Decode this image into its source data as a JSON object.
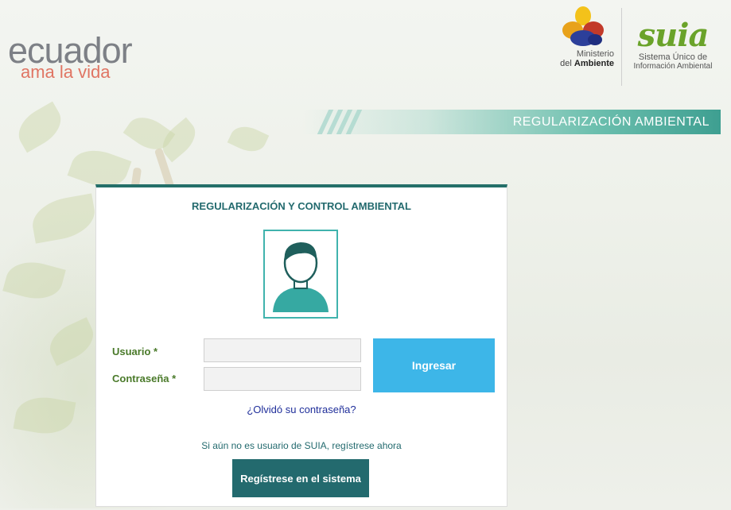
{
  "header": {
    "brand_main": "ecuador",
    "brand_sub": "ama la vida",
    "ministry_line1": "Ministerio",
    "ministry_line2_prefix": "del ",
    "ministry_line2_bold": "Ambiente",
    "suia_logo": "suia",
    "suia_line1": "Sistema Único de",
    "suia_line2": "Información Ambiental",
    "banner_text": "REGULARIZACIÓN AMBIENTAL"
  },
  "login": {
    "title": "REGULARIZACIÓN Y CONTROL AMBIENTAL",
    "avatar_icon": "user-avatar-icon",
    "user_label": "Usuario *",
    "user_value": "",
    "password_label": "Contraseña *",
    "password_value": "",
    "submit_label": "Ingresar",
    "forgot_link": "¿Olvidó su contraseña?",
    "register_hint": "Si aún no es usuario de SUIA, regístrese ahora",
    "register_button": "Regístrese en el sistema"
  },
  "colors": {
    "accent_teal": "#236a6e",
    "accent_blue": "#3db6e8",
    "label_green": "#4a7a2a",
    "brand_gray": "#7d8086",
    "brand_coral": "#e07563"
  }
}
